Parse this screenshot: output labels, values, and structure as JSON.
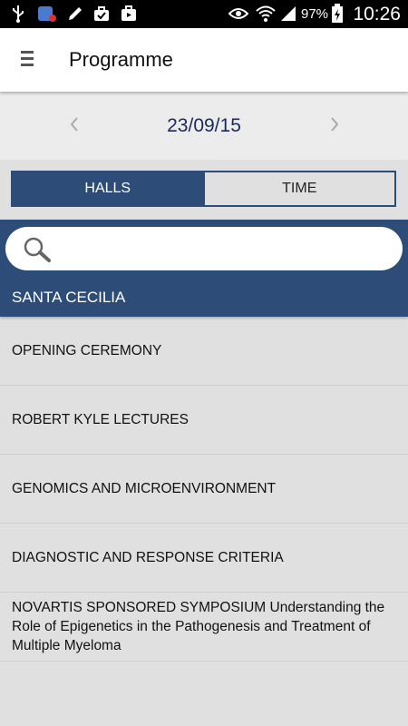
{
  "status_bar": {
    "battery": "97%",
    "time": "10:26",
    "icons": [
      "usb-icon",
      "app-notification-icon",
      "edit-icon",
      "briefcase-icon",
      "media-icon",
      "eye-icon",
      "wifi-icon",
      "signal-icon",
      "battery-charging-icon"
    ]
  },
  "app_bar": {
    "title": "Programme",
    "menu_icon": "hamburger-menu-icon"
  },
  "date_nav": {
    "date": "23/09/15",
    "prev_icon": "chevron-left-icon",
    "next_icon": "chevron-right-icon"
  },
  "tabs": [
    {
      "label": "HALLS",
      "selected": true
    },
    {
      "label": "TIME",
      "selected": false
    }
  ],
  "search": {
    "placeholder": "",
    "value": "",
    "icon": "search-icon"
  },
  "section": {
    "title": "SANTA CECILIA"
  },
  "sessions": [
    "OPENING CEREMONY",
    "ROBERT KYLE LECTURES",
    "GENOMICS AND MICROENVIRONMENT",
    "DIAGNOSTIC AND RESPONSE CRITERIA",
    "NOVARTIS SPONSORED SYMPOSIUM Understanding the Role of Epigenetics in the Pathogenesis and Treatment of Multiple Myeloma"
  ],
  "colors": {
    "primary": "#2d4d78",
    "date_text": "#1a2a5a",
    "background": "#e0e0e0"
  }
}
